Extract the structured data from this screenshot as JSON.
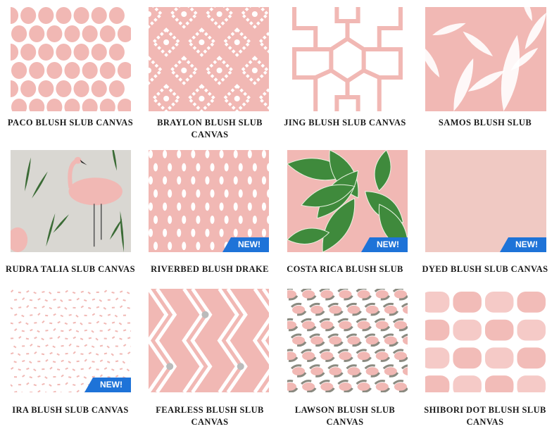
{
  "colors": {
    "blush": "#f1b8b4",
    "blush_light": "#f7d4d0",
    "badge_blue": "#1e73d8"
  },
  "products": [
    {
      "title": "PACO BLUSH SLUB CANVAS",
      "pattern": "dots",
      "is_new": false
    },
    {
      "title": "BRAYLON BLUSH SLUB CANVAS",
      "title_line1": "BRAYLON BLUSH SLUB",
      "title_line2": "CANVAS",
      "pattern": "ikat",
      "is_new": false
    },
    {
      "title": "JING BLUSH SLUB CANVAS",
      "pattern": "fretwork",
      "is_new": false
    },
    {
      "title": "SAMOS BLUSH SLUB",
      "pattern": "leaves",
      "is_new": false
    },
    {
      "title": "RUDRA TALIA SLUB CANVAS",
      "pattern": "flamingo",
      "is_new": false
    },
    {
      "title": "RIVERBED BLUSH DRAKE",
      "pattern": "drops",
      "is_new": true
    },
    {
      "title": "COSTA RICA BLUSH SLUB",
      "pattern": "palm",
      "is_new": true
    },
    {
      "title": "DYED BLUSH SLUB CANVAS",
      "pattern": "solid",
      "is_new": true
    },
    {
      "title": "IRA BLUSH SLUB CANVAS",
      "pattern": "flecks",
      "is_new": true
    },
    {
      "title": "FEARLESS BLUSH SLUB CANVAS",
      "title_line1": "FEARLESS BLUSH SLUB",
      "title_line2": "CANVAS",
      "pattern": "diamonds",
      "is_new": false
    },
    {
      "title": "LAWSON BLUSH SLUB CANVAS",
      "title_line1": "LAWSON BLUSH SLUB",
      "title_line2": "CANVAS",
      "pattern": "leopard",
      "is_new": false
    },
    {
      "title": "SHIBORI DOT BLUSH SLUB CANVAS",
      "title_line1": "SHIBORI DOT BLUSH SLUB",
      "title_line2": "CANVAS",
      "pattern": "shibori",
      "is_new": false
    }
  ],
  "badge_label": "NEW!"
}
